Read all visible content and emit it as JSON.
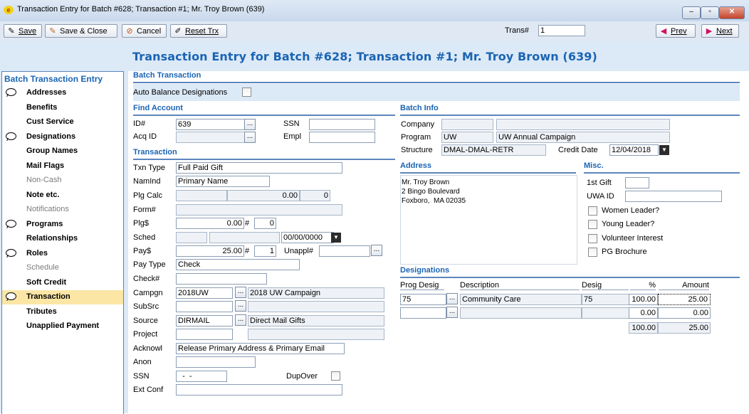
{
  "window": {
    "title": "Transaction Entry for Batch #628; Transaction #1; Mr. Troy Brown (639)",
    "min": "–",
    "max": "▫",
    "close": "✕"
  },
  "toolbar": {
    "save": "Save",
    "save_close": "Save & Close",
    "cancel": "Cancel",
    "reset": "Reset Trx",
    "trans_label": "Trans#",
    "trans_value": "1",
    "prev": "Prev",
    "next": "Next"
  },
  "page_title": "Transaction Entry for Batch #628; Transaction #1; Mr. Troy Brown (639)",
  "sidebar": {
    "header": "Batch Transaction Entry",
    "items": [
      {
        "label": "Addresses",
        "icon": true,
        "dim": false
      },
      {
        "label": "Benefits",
        "icon": false,
        "dim": false
      },
      {
        "label": "Cust Service",
        "icon": false,
        "dim": false
      },
      {
        "label": "Designations",
        "icon": true,
        "dim": false
      },
      {
        "label": "Group Names",
        "icon": false,
        "dim": false
      },
      {
        "label": "Mail Flags",
        "icon": false,
        "dim": false
      },
      {
        "label": "Non-Cash",
        "icon": false,
        "dim": true
      },
      {
        "label": "Note etc.",
        "icon": false,
        "dim": false
      },
      {
        "label": "Notifications",
        "icon": false,
        "dim": true
      },
      {
        "label": "Programs",
        "icon": true,
        "dim": false
      },
      {
        "label": "Relationships",
        "icon": false,
        "dim": false
      },
      {
        "label": "Roles",
        "icon": true,
        "dim": false
      },
      {
        "label": "Schedule",
        "icon": false,
        "dim": true
      },
      {
        "label": "Soft Credit",
        "icon": false,
        "dim": false
      },
      {
        "label": "Transaction",
        "icon": true,
        "dim": false,
        "selected": true
      },
      {
        "label": "Tributes",
        "icon": false,
        "dim": false
      },
      {
        "label": "Unapplied Payment",
        "icon": false,
        "dim": false
      }
    ]
  },
  "batch_transaction": {
    "header": "Batch Transaction",
    "auto_balance_label": "Auto Balance Designations"
  },
  "find_account": {
    "header": "Find Account",
    "id_label": "ID#",
    "id_value": "639",
    "acq_label": "Acq ID",
    "acq_value": "",
    "ssn_label": "SSN",
    "ssn_value": "",
    "empl_label": "Empl",
    "empl_value": ""
  },
  "transaction": {
    "header": "Transaction",
    "txn_type_label": "Txn Type",
    "txn_type": "Full Paid Gift",
    "namind_label": "NamInd",
    "namind": "Primary Name",
    "plg_calc_label": "Plg Calc",
    "plg_calc_a": "",
    "plg_calc_amt": "0.00",
    "plg_calc_n": "0",
    "form_label": "Form#",
    "form": "",
    "plg_label": "Plg$",
    "plg_amt": "0.00",
    "plg_hash": "#",
    "plg_n": "0",
    "sched_label": "Sched",
    "sched_a": "",
    "sched_b": "",
    "sched_date": "00/00/0000",
    "pay_label": "Pay$",
    "pay_amt": "25.00",
    "pay_hash": "#",
    "pay_n": "1",
    "unappl_label": "Unappl#",
    "unappl": "",
    "pay_type_label": "Pay Type",
    "pay_type": "Check",
    "check_label": "Check#",
    "check": "",
    "campgn_label": "Campgn",
    "campgn": "2018UW",
    "campgn_desc": "2018 UW Campaign",
    "subsrc_label": "SubSrc",
    "subsrc": "",
    "subsrc_desc": "",
    "source_label": "Source",
    "source": "DIRMAIL",
    "source_desc": "Direct Mail Gifts",
    "project_label": "Project",
    "project": "",
    "project_desc": "",
    "acknowl_label": "Acknowl",
    "acknowl": "Release Primary Address & Primary Email",
    "anon_label": "Anon",
    "anon": "",
    "ssn_label": "SSN",
    "ssn": "  -  -",
    "dupover_label": "DupOver",
    "extconf_label": "Ext Conf",
    "extconf": ""
  },
  "batch_info": {
    "header": "Batch Info",
    "company_label": "Company",
    "company_code": "",
    "company_name": "",
    "program_label": "Program",
    "program_code": "UW",
    "program_name": "UW Annual Campaign",
    "structure_label": "Structure",
    "structure": "DMAL-DMAL-RETR",
    "credit_date_label": "Credit Date",
    "credit_date": "12/04/2018"
  },
  "address": {
    "header": "Address",
    "lines": [
      "Mr. Troy Brown",
      "2 Bingo Boulevard",
      "Foxboro,  MA 02035"
    ]
  },
  "misc": {
    "header": "Misc.",
    "first_gift_label": "1st Gift",
    "first_gift": "",
    "uwa_label": "UWA ID",
    "uwa": "",
    "women_leader": "Women Leader?",
    "young_leader": "Young Leader?",
    "volunteer": "Volunteer Interest",
    "pg_brochure": "PG Brochure"
  },
  "designations": {
    "header": "Designations",
    "columns": [
      "Prog Desig",
      "Description",
      "Desig",
      "%",
      "Amount"
    ],
    "rows": [
      {
        "prog": "75",
        "desc": "Community Care",
        "desig": "75",
        "pct": "100.00",
        "amount": "25.00"
      },
      {
        "prog": "",
        "desc": "",
        "desig": "",
        "pct": "0.00",
        "amount": "0.00"
      }
    ],
    "total_pct": "100.00",
    "total_amount": "25.00"
  }
}
